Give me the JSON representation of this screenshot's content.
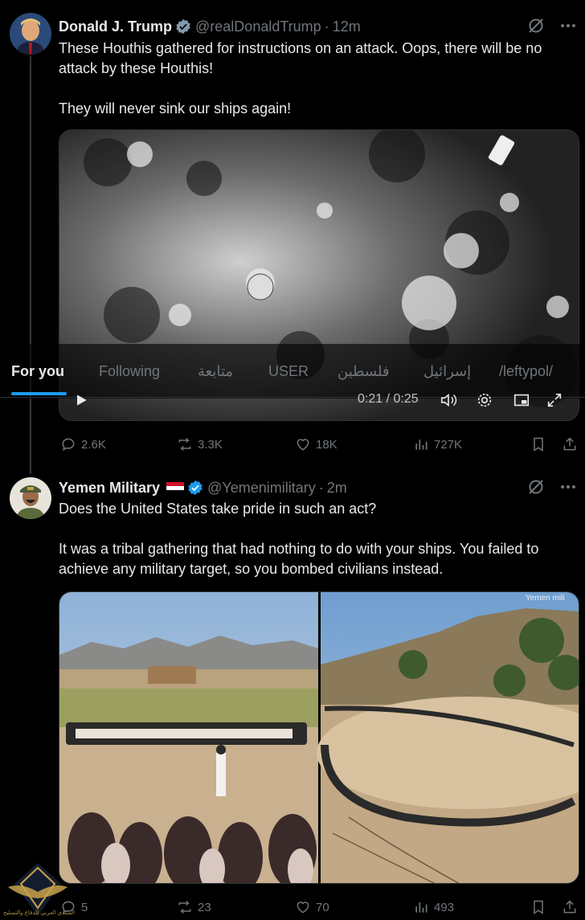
{
  "tweets": [
    {
      "name": "Donald J. Trump",
      "handle": "@realDonaldTrump",
      "time": "12m",
      "text": "These Houthis gathered for instructions on an attack. Oops, there will be no attack by these Houthis!\n\nThey will never sink our ships again!",
      "video": {
        "time_display": "0:21 / 0:25"
      },
      "stats": {
        "replies": "2.6K",
        "reposts": "3.3K",
        "likes": "18K",
        "views": "727K"
      }
    },
    {
      "name": "Yemen Military",
      "handle": "@Yemenimilitary",
      "time": "2m",
      "text": "Does the United States take pride in such an act?\n\nIt was a tribal gathering that had nothing to do with your ships. You failed to achieve any military target, so you bombed civilians instead.",
      "photo_watermark": "Yemen mili",
      "stats": {
        "replies": "5",
        "reposts": "23",
        "likes": "70",
        "views": "493"
      }
    }
  ],
  "tabs": [
    "For you",
    "Following",
    "متابعة",
    "USER",
    "فلسطين",
    "إسرائيل",
    "/leftypol/"
  ],
  "active_tab": "For you",
  "watermark_text": "المنتدى العربي للدفاع والتسليح",
  "colors": {
    "accent": "#1d9bf0",
    "muted": "#71767b",
    "text": "#e7e9ea",
    "background": "#000000"
  },
  "icons": [
    "grok-icon",
    "more-icon",
    "reply-icon",
    "repost-icon",
    "like-icon",
    "views-icon",
    "bookmark-icon",
    "share-icon",
    "play-icon",
    "volume-icon",
    "settings-icon",
    "pip-icon",
    "fullscreen-icon",
    "verified-icon",
    "yemen-flag-icon"
  ]
}
